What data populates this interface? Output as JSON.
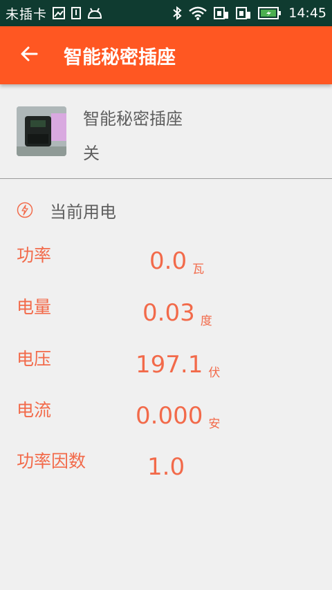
{
  "status_bar": {
    "carrier": "未插卡",
    "time": "14:45",
    "left_icons": [
      "image-icon",
      "sim-icon",
      "android-icon"
    ],
    "right_icons": [
      "bluetooth-icon",
      "wifi-icon",
      "sim-slot-icon",
      "sim-slot-icon",
      "battery-charging-icon"
    ]
  },
  "app_bar": {
    "title": "智能秘密插座",
    "back_icon": "arrow-left-icon",
    "background_color": "#ff5722"
  },
  "device": {
    "name": "智能秘密插座",
    "state": "关"
  },
  "section": {
    "title": "当前用电",
    "icon": "lightning-icon"
  },
  "metrics": [
    {
      "label": "功率",
      "value": "0.0",
      "unit": "瓦"
    },
    {
      "label": "电量",
      "value": "0.03",
      "unit": "度"
    },
    {
      "label": "电压",
      "value": "197.1",
      "unit": "伏"
    },
    {
      "label": "电流",
      "value": "0.000",
      "unit": "安"
    },
    {
      "label": "功率因数",
      "value": "1.0",
      "unit": ""
    }
  ],
  "colors": {
    "accent": "#ff5722",
    "metric_text": "#f26a4a",
    "status_bar": "#0f3b30"
  }
}
